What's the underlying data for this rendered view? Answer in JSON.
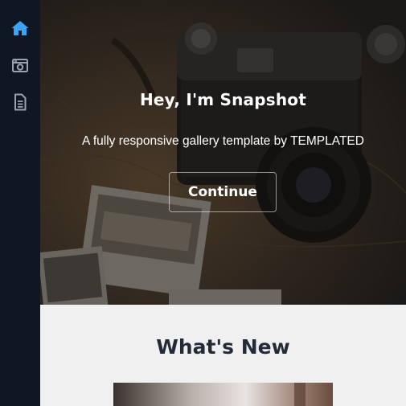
{
  "sidebar": {
    "items": [
      {
        "icon": "home-icon",
        "active": true
      },
      {
        "icon": "camera-icon",
        "active": false
      },
      {
        "icon": "document-icon",
        "active": false
      }
    ],
    "active_color": "#3ea3f5",
    "inactive_color": "#9aa3ad"
  },
  "banner": {
    "title": "Hey, I'm Snapshot",
    "subtitle": "A fully responsive gallery template by TEMPLATED",
    "button_label": "Continue"
  },
  "section": {
    "title": "What's New"
  }
}
